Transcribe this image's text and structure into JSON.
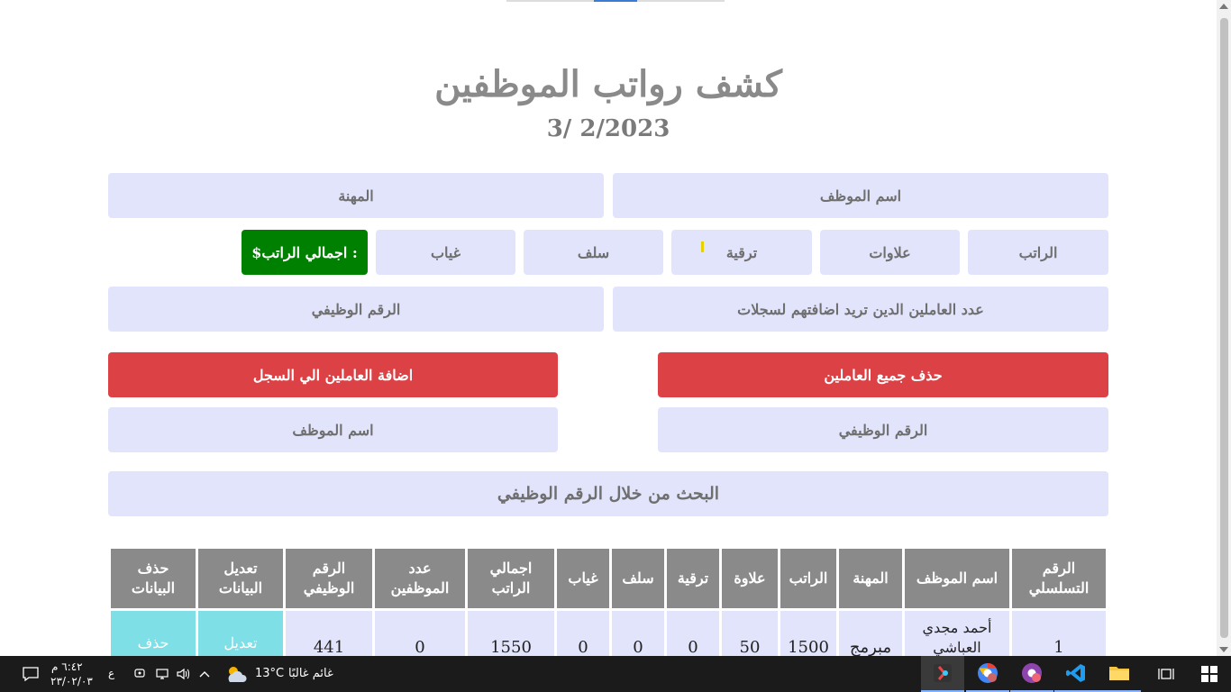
{
  "header": {
    "title": "كشف رواتب الموظفين",
    "date": "3/ 2/2023"
  },
  "form": {
    "employee_name": "اسم الموظف",
    "profession": "المهنة",
    "salary": "الراتب",
    "bonuses": "علاوات",
    "promotion": "ترقية",
    "advances": "سلف",
    "absence": "غياب",
    "total_salary": ": اجمالي الراتب$",
    "count": "عدد العاملين الدين تريد اضافتهم لسجلات",
    "job_number": "الرقم الوظيفي"
  },
  "actions": {
    "delete_all": "حذف جميع العاملين",
    "add_workers": "اضافة العاملين الي السجل",
    "search_job_number": "الرقم الوظيفي",
    "search_name": "اسم الموظف",
    "search_bar": "البحث من خلال الرقم الوظيفي"
  },
  "table": {
    "headers": [
      "الرقم التسلسلي",
      "اسم الموظف",
      "المهنة",
      "الراتب",
      "علاوة",
      "ترقية",
      "سلف",
      "غياب",
      "اجمالي الراتب",
      "عدد الموظفين",
      "الرقم الوظيفي",
      "تعديل البيانات",
      "حذف البيانات"
    ],
    "rows": [
      [
        "1",
        "أحمد مجدي العباشي",
        "مبرمج",
        "1500",
        "50",
        "0",
        "0",
        "0",
        "1550",
        "0",
        "441",
        "تعديل",
        "حذف"
      ]
    ]
  },
  "taskbar": {
    "weather": "غائم غالبًا",
    "temperature": "13°C",
    "lang": "ع",
    "time": "٦:٤٢ م",
    "date": "٢٣/٠٢/٠٣",
    "apps": [
      "desktop-app-icon",
      "browser-colorful-icon",
      "browser-purple-icon",
      "vscode-icon",
      "file-explorer-icon",
      "task-view-icon",
      "start-icon"
    ]
  }
}
